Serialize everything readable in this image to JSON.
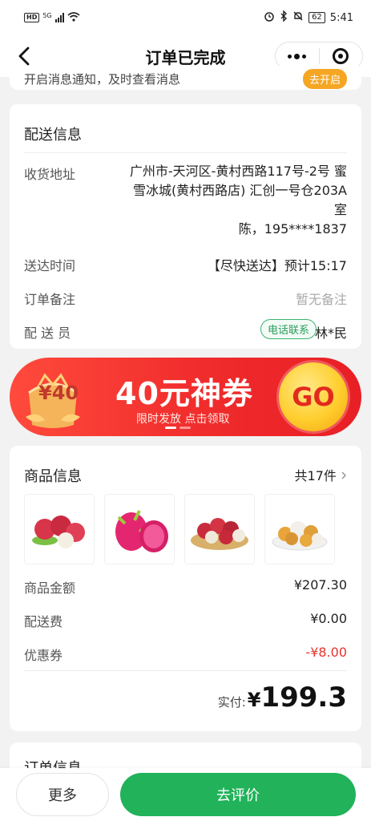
{
  "status_bar": {
    "hd_label": "HD",
    "network_label": "5G",
    "battery": "62",
    "time": "5:41"
  },
  "nav": {
    "title": "订单已完成"
  },
  "notice": {
    "text": "开启消息通知，及时查看消息",
    "button_label": "去开启"
  },
  "delivery": {
    "title": "配送信息",
    "address_label": "收货地址",
    "address_lines": [
      "广州市-天河区-黄村西路117号-2号 蜜",
      "雪冰城(黄村西路店) 汇创一号仓203A",
      "室"
    ],
    "contact": "陈，195****1837",
    "time_label": "送达时间",
    "time_value": "【尽快送达】预计15:17",
    "remark_label": "订单备注",
    "remark_value": "暂无备注",
    "courier_label": "配 送 员",
    "courier_call_label": "电话联系",
    "courier_name": "林*民"
  },
  "banner": {
    "coupon_badge": "¥40",
    "headline": "40元神券",
    "subline": "限时发放 点击领取",
    "go_label": "GO"
  },
  "goods": {
    "title": "商品信息",
    "count_label": "共17件",
    "items": [
      {
        "icon": "lychee-image"
      },
      {
        "icon": "dragon-fruit-image"
      },
      {
        "icon": "lychee-basket-image"
      },
      {
        "icon": "longan-bowl-image"
      }
    ],
    "amount_label": "商品金额",
    "amount_value": "¥207.30",
    "shipping_label": "配送费",
    "shipping_value": "¥0.00",
    "coupon_label": "优惠券",
    "coupon_value": "-¥8.00",
    "paid_label": "实付:",
    "paid_currency": "¥",
    "paid_amount": "199.3"
  },
  "order": {
    "title": "订单信息"
  },
  "bottom": {
    "more_label": "更多",
    "review_label": "去评价"
  },
  "colors": {
    "primary_green": "#21b25a",
    "discount_red": "#e8342d",
    "banner_red": "#f02c2c",
    "notice_orange": "#f5a623"
  }
}
